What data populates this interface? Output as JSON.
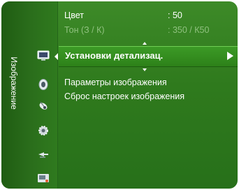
{
  "sidebar": {
    "title": "Изображение",
    "icons": [
      "picture-icon",
      "sound-icon",
      "channel-icon",
      "setup-icon",
      "input-icon",
      "application-icon"
    ]
  },
  "menu": {
    "items": [
      {
        "label": "Цвет",
        "value": ": 50",
        "enabled": true
      },
      {
        "label": "Тон (З / К)",
        "value": ": 350 / К50",
        "enabled": false
      },
      {
        "label": "Установки детализац.",
        "selected": true
      },
      {
        "label": "Параметры изображения"
      },
      {
        "label": "Сброс настроек изображения"
      }
    ]
  },
  "colors": {
    "panel": "#2f7a1d",
    "selected_bar": "#3c9a26",
    "text": "#ffffff",
    "disabled_text": "#8fc17f"
  }
}
